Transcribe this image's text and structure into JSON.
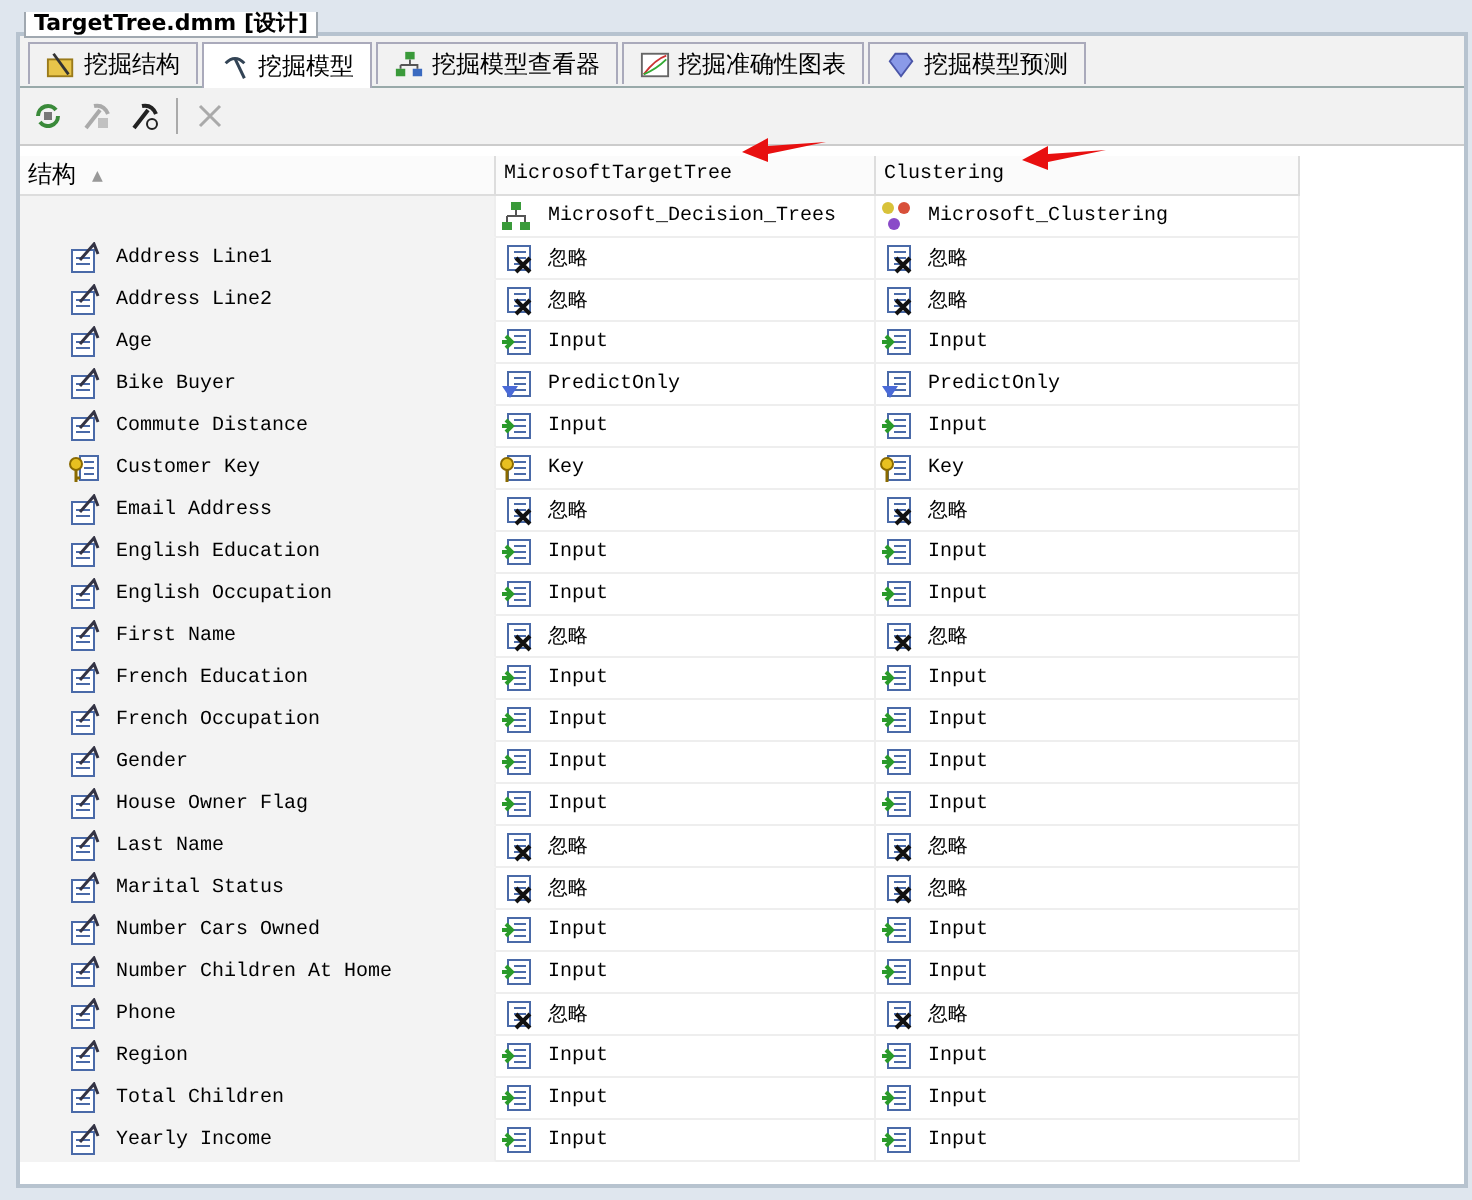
{
  "document_tab": {
    "title": "TargetTree.dmm [设计]"
  },
  "tabs": [
    {
      "label": "挖掘结构",
      "kind": "structure",
      "selected": false
    },
    {
      "label": "挖掘模型",
      "kind": "model",
      "selected": true
    },
    {
      "label": "挖掘模型查看器",
      "kind": "viewer",
      "selected": false
    },
    {
      "label": "挖掘准确性图表",
      "kind": "chart",
      "selected": false
    },
    {
      "label": "挖掘模型预测",
      "kind": "predict",
      "selected": false
    }
  ],
  "toolbar": [
    {
      "kind": "refresh",
      "disabled": false
    },
    {
      "kind": "add",
      "disabled": true
    },
    {
      "kind": "tools",
      "disabled": false
    },
    {
      "kind": "delete",
      "disabled": true
    }
  ],
  "grid": {
    "structure_header": "结构",
    "sort_glyph": "▲",
    "models": [
      {
        "name": "MicrosoftTargetTree",
        "algorithm": "Microsoft_Decision_Trees",
        "kind": "tree"
      },
      {
        "name": "Clustering",
        "algorithm": "Microsoft_Clustering",
        "kind": "cluster"
      }
    ],
    "rows": [
      {
        "name": "Address Line1",
        "kind": "column",
        "usages": [
          {
            "kind": "ignore",
            "label": "忽略"
          },
          {
            "kind": "ignore",
            "label": "忽略"
          }
        ]
      },
      {
        "name": "Address Line2",
        "kind": "column",
        "usages": [
          {
            "kind": "ignore",
            "label": "忽略"
          },
          {
            "kind": "ignore",
            "label": "忽略"
          }
        ]
      },
      {
        "name": "Age",
        "kind": "column",
        "usages": [
          {
            "kind": "input",
            "label": "Input"
          },
          {
            "kind": "input",
            "label": "Input"
          }
        ]
      },
      {
        "name": "Bike Buyer",
        "kind": "column",
        "usages": [
          {
            "kind": "predict",
            "label": "PredictOnly"
          },
          {
            "kind": "predict",
            "label": "PredictOnly"
          }
        ]
      },
      {
        "name": "Commute Distance",
        "kind": "column",
        "usages": [
          {
            "kind": "input",
            "label": "Input"
          },
          {
            "kind": "input",
            "label": "Input"
          }
        ]
      },
      {
        "name": "Customer Key",
        "kind": "key",
        "usages": [
          {
            "kind": "key",
            "label": "Key"
          },
          {
            "kind": "key",
            "label": "Key"
          }
        ]
      },
      {
        "name": "Email Address",
        "kind": "column",
        "usages": [
          {
            "kind": "ignore",
            "label": "忽略"
          },
          {
            "kind": "ignore",
            "label": "忽略"
          }
        ]
      },
      {
        "name": "English Education",
        "kind": "column",
        "usages": [
          {
            "kind": "input",
            "label": "Input"
          },
          {
            "kind": "input",
            "label": "Input"
          }
        ]
      },
      {
        "name": "English Occupation",
        "kind": "column",
        "usages": [
          {
            "kind": "input",
            "label": "Input"
          },
          {
            "kind": "input",
            "label": "Input"
          }
        ]
      },
      {
        "name": "First Name",
        "kind": "column",
        "usages": [
          {
            "kind": "ignore",
            "label": "忽略"
          },
          {
            "kind": "ignore",
            "label": "忽略"
          }
        ]
      },
      {
        "name": "French Education",
        "kind": "column",
        "usages": [
          {
            "kind": "input",
            "label": "Input"
          },
          {
            "kind": "input",
            "label": "Input"
          }
        ]
      },
      {
        "name": "French Occupation",
        "kind": "column",
        "usages": [
          {
            "kind": "input",
            "label": "Input"
          },
          {
            "kind": "input",
            "label": "Input"
          }
        ]
      },
      {
        "name": "Gender",
        "kind": "column",
        "usages": [
          {
            "kind": "input",
            "label": "Input"
          },
          {
            "kind": "input",
            "label": "Input"
          }
        ]
      },
      {
        "name": "House Owner Flag",
        "kind": "column",
        "usages": [
          {
            "kind": "input",
            "label": "Input"
          },
          {
            "kind": "input",
            "label": "Input"
          }
        ]
      },
      {
        "name": "Last Name",
        "kind": "column",
        "usages": [
          {
            "kind": "ignore",
            "label": "忽略"
          },
          {
            "kind": "ignore",
            "label": "忽略"
          }
        ]
      },
      {
        "name": "Marital Status",
        "kind": "column",
        "usages": [
          {
            "kind": "ignore",
            "label": "忽略"
          },
          {
            "kind": "ignore",
            "label": "忽略"
          }
        ]
      },
      {
        "name": "Number Cars Owned",
        "kind": "column",
        "usages": [
          {
            "kind": "input",
            "label": "Input"
          },
          {
            "kind": "input",
            "label": "Input"
          }
        ]
      },
      {
        "name": "Number Children At Home",
        "kind": "column",
        "usages": [
          {
            "kind": "input",
            "label": "Input"
          },
          {
            "kind": "input",
            "label": "Input"
          }
        ]
      },
      {
        "name": "Phone",
        "kind": "column",
        "usages": [
          {
            "kind": "ignore",
            "label": "忽略"
          },
          {
            "kind": "ignore",
            "label": "忽略"
          }
        ]
      },
      {
        "name": "Region",
        "kind": "column",
        "usages": [
          {
            "kind": "input",
            "label": "Input"
          },
          {
            "kind": "input",
            "label": "Input"
          }
        ]
      },
      {
        "name": "Total Children",
        "kind": "column",
        "usages": [
          {
            "kind": "input",
            "label": "Input"
          },
          {
            "kind": "input",
            "label": "Input"
          }
        ]
      },
      {
        "name": "Yearly Income",
        "kind": "column",
        "usages": [
          {
            "kind": "input",
            "label": "Input"
          },
          {
            "kind": "input",
            "label": "Input"
          }
        ]
      }
    ]
  }
}
